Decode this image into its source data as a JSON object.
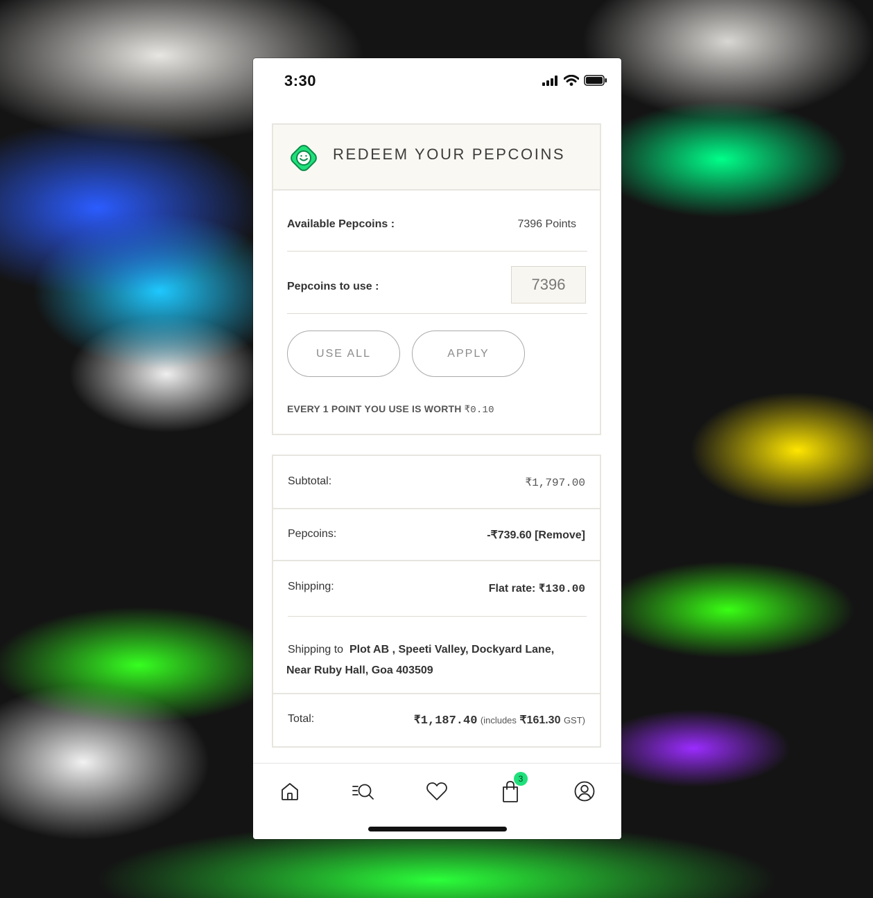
{
  "status_bar": {
    "time": "3:30",
    "icons": [
      "signal-icon",
      "wifi-icon",
      "battery-icon"
    ]
  },
  "redeem": {
    "title": "REDEEM YOUR PEPCOINS",
    "icon": "pepcoin-icon",
    "available_label": "Available Pepcoins :",
    "available_value": "7396 Points",
    "use_label": "Pepcoins to use :",
    "use_input_value": "7396",
    "use_all_label": "USE ALL",
    "apply_label": "APPLY",
    "worth_prefix": "EVERY 1 POINT YOU USE IS WORTH ",
    "worth_value": "₹0.10"
  },
  "summary": {
    "subtotal_label": "Subtotal:",
    "subtotal_value": "₹1,797.00",
    "pepcoins_label": "Pepcoins:",
    "pepcoins_value": "-₹739.60",
    "remove_label": "[Remove]",
    "shipping_label": "Shipping:",
    "shipping_prefix": "Flat rate: ",
    "shipping_value": "₹130.00",
    "shipping_to_label": "Shipping to",
    "shipping_address_line1": "Plot AB , Speeti Valley, Dockyard Lane,",
    "shipping_address_line2": "Near Ruby Hall, Goa 403509",
    "total_label": "Total:",
    "total_value": "₹1,187.40",
    "includes_prefix": "(includes",
    "gst_value": "₹161.30",
    "gst_suffix": "GST)"
  },
  "nav": {
    "items": [
      "home-icon",
      "search-list-icon",
      "heart-icon",
      "bag-icon",
      "profile-icon"
    ],
    "cart_badge": "3"
  },
  "colors": {
    "accent_green": "#1fe07a",
    "header_bg": "#faf8f3",
    "border": "#e7e5df"
  }
}
